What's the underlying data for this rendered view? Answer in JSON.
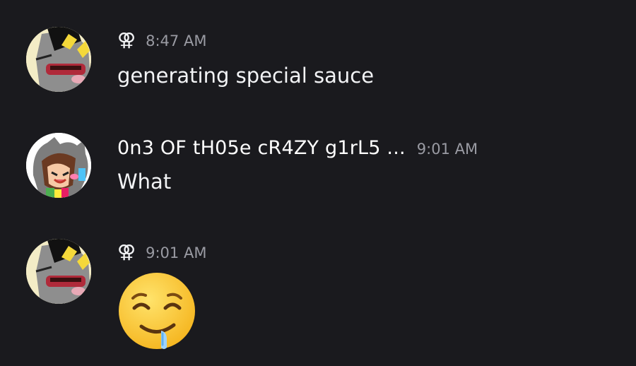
{
  "messages": [
    {
      "username": "",
      "role_glyph": "⚢",
      "timestamp": "8:47 AM",
      "text": "generating special sauce",
      "avatar_icon": "bunny-avatar"
    },
    {
      "username": "0n3 OF tH05e cR4ZY g1rL5 ...",
      "timestamp": "9:01 AM",
      "text": "What",
      "avatar_icon": "cat-hood-girl-avatar"
    },
    {
      "username": "",
      "role_glyph": "⚢",
      "timestamp": "9:01 AM",
      "emoji": "drooling-face",
      "avatar_icon": "bunny-avatar"
    }
  ],
  "colors": {
    "background": "#1a1a1e",
    "text": "#f2f3f5",
    "timestamp": "#9a9ba3"
  }
}
